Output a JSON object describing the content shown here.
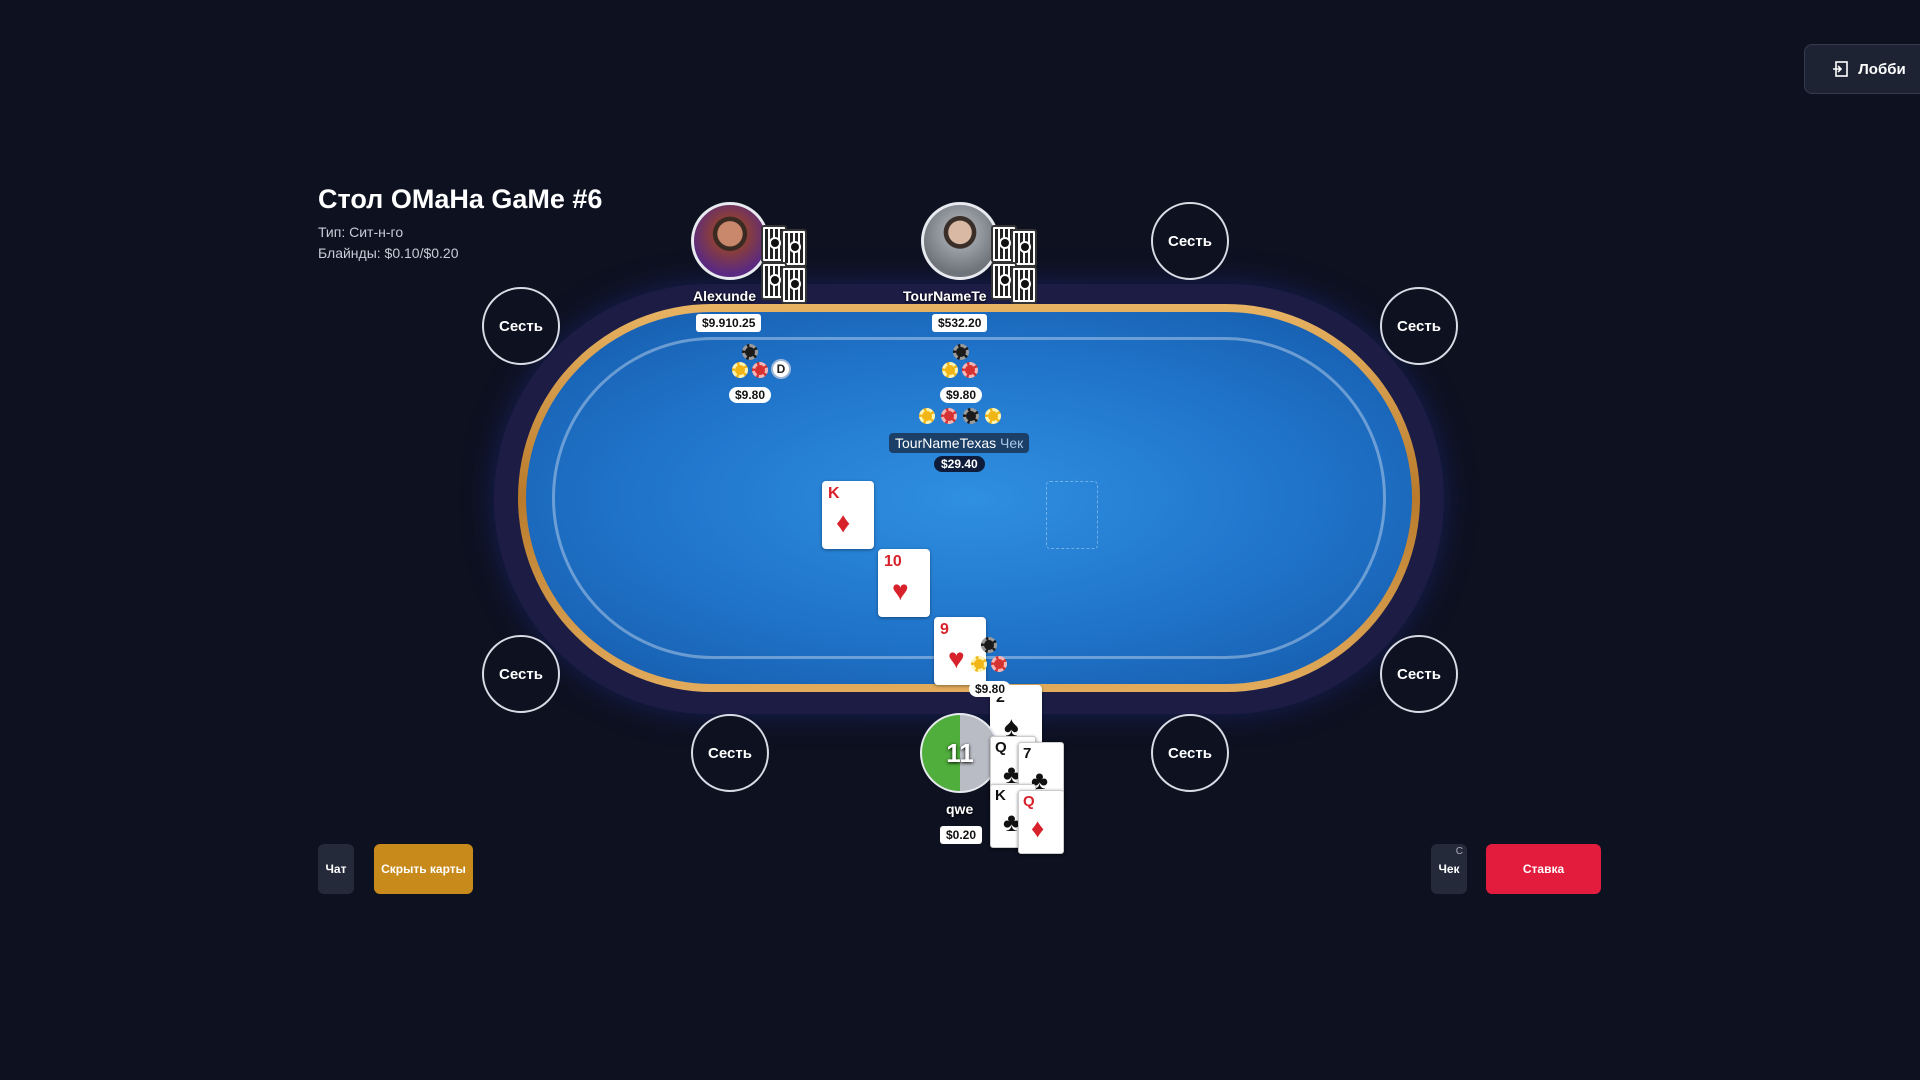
{
  "lobby": {
    "label": "Лобби"
  },
  "table": {
    "title": "Стол OMaHa GaMe #6",
    "type_line": "Тип: Сит-н-го",
    "blinds_line": "Блайнды: $0.10/$0.20"
  },
  "seats": {
    "empty_label": "Сесть"
  },
  "players": [
    {
      "name": "Alexunde",
      "stack": "$9.910.25",
      "bet": "$9.80",
      "dealer": "D"
    },
    {
      "name": "TourNameTe",
      "stack": "$532.20",
      "bet": "$9.80"
    },
    {
      "name": "qwe",
      "stack": "$0.20",
      "bet": "$9.80",
      "timer": "11"
    }
  ],
  "action": {
    "player": "TourNameTexas",
    "status": "Чек"
  },
  "pot": "$29.40",
  "board": [
    {
      "rank": "K",
      "suit": "♦",
      "color": "#d8222b"
    },
    {
      "rank": "10",
      "suit": "♥",
      "color": "#d8222b"
    },
    {
      "rank": "9",
      "suit": "♥",
      "color": "#d8222b"
    },
    {
      "rank": "2",
      "suit": "♠",
      "color": "#111111"
    }
  ],
  "hero_cards": [
    {
      "rank": "Q",
      "suit": "♣",
      "color": "#111111"
    },
    {
      "rank": "7",
      "suit": "♣",
      "color": "#111111"
    },
    {
      "rank": "K",
      "suit": "♣",
      "color": "#111111"
    },
    {
      "rank": "Q",
      "suit": "♦",
      "color": "#d8222b"
    }
  ],
  "controls": {
    "chat": "Чат",
    "hide_cards": "Скрыть карты",
    "check": "Чек",
    "check_hotkey": "C",
    "bet": "Ставка"
  },
  "colors": {
    "bet_button": "#e31c3d",
    "hide_button": "#c98a1c",
    "felt": "#1f73c9"
  }
}
